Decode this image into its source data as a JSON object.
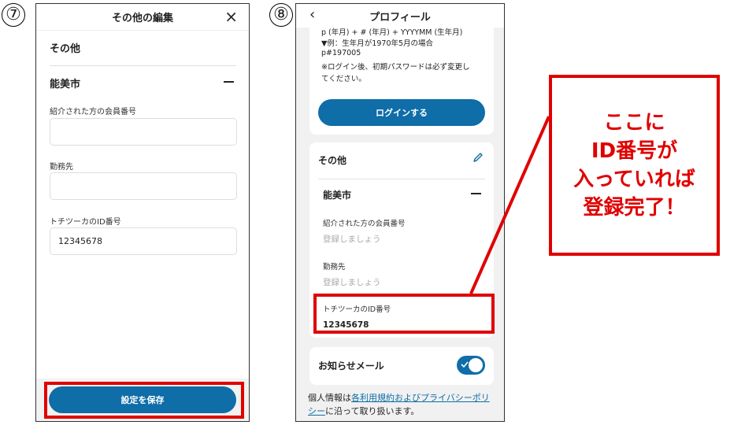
{
  "steps": {
    "left": "⑦",
    "right": "⑧"
  },
  "screen7": {
    "title": "その他の編集",
    "close_icon": "×",
    "section": "その他",
    "city": "能美市",
    "fields": [
      {
        "label": "紹介された方の会員番号",
        "value": ""
      },
      {
        "label": "勤務先",
        "value": ""
      },
      {
        "label": "トチツーカのID番号",
        "value": "12345678"
      }
    ],
    "save_button": "設定を保存"
  },
  "screen8": {
    "title": "プロフィール",
    "back_icon": "‹",
    "notes": [
      "p (年月) + # (年月) + YYYYMM (生年月)",
      "▼例：生年月が1970年5月の場合",
      "p#197005",
      "※ログイン後、初期パスワードは必ず変更し",
      "てください。"
    ],
    "login_button": "ログインする",
    "section": "その他",
    "city": "能美市",
    "fields": [
      {
        "label": "紹介された方の会員番号",
        "placeholder": "登録しましょう"
      },
      {
        "label": "勤務先",
        "placeholder": "登録しましょう"
      }
    ],
    "id_field": {
      "label": "トチツーカのID番号",
      "value": "12345678"
    },
    "mail_label": "お知らせメール",
    "mail_enabled": true,
    "privacy": {
      "prefix": "個人情報は",
      "link": "各利用規約およびプライバシーポリシー",
      "suffix": "に沿って取り扱います。"
    }
  },
  "callout": {
    "lines": [
      "ここに",
      "ID番号が",
      "入っていれば",
      "登録完了！"
    ],
    "color": "#e00000"
  },
  "colors": {
    "accent": "#0f6da8",
    "highlight": "#e00000"
  }
}
